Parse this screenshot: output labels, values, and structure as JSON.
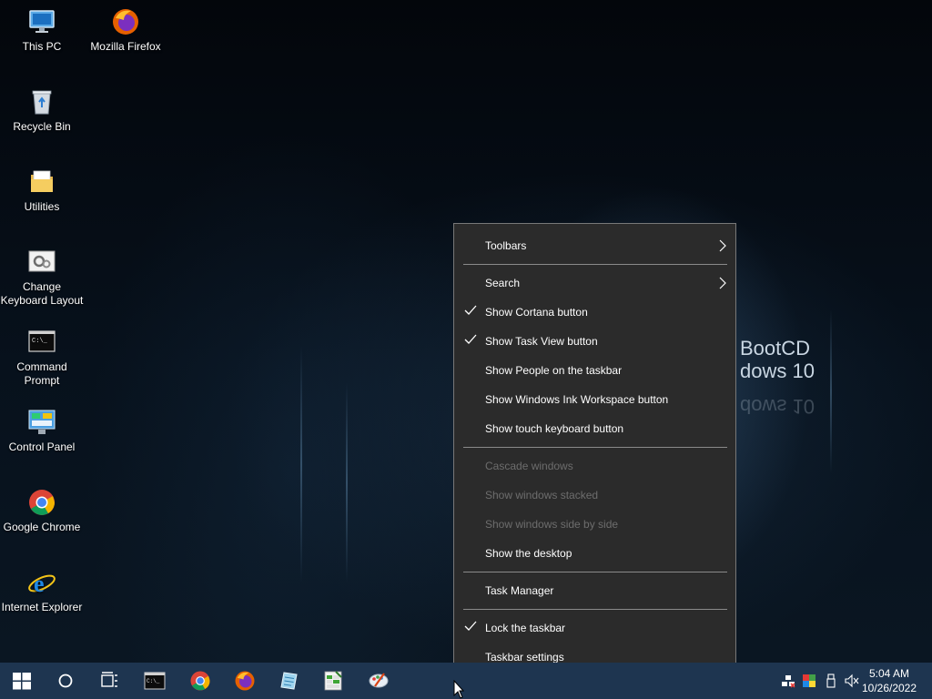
{
  "wallpaper": {
    "line1": "BootCD",
    "line2": "dows 10"
  },
  "desktop_icons": [
    {
      "label": "This PC",
      "icon": "computer-icon"
    },
    {
      "label": "Mozilla Firefox",
      "icon": "firefox-icon"
    },
    {
      "label": "Recycle Bin",
      "icon": "recycle-bin-icon"
    },
    {
      "label": "Utilities",
      "icon": "folder-icon"
    },
    {
      "label": "Change Keyboard Layout",
      "icon": "keyboard-settings-icon"
    },
    {
      "label": "Command Prompt",
      "icon": "command-prompt-icon"
    },
    {
      "label": "Control Panel",
      "icon": "control-panel-icon"
    },
    {
      "label": "Google Chrome",
      "icon": "chrome-icon"
    },
    {
      "label": "Internet Explorer",
      "icon": "internet-explorer-icon"
    }
  ],
  "context_menu": {
    "toolbars": "Toolbars",
    "search": "Search",
    "show_cortana": "Show Cortana button",
    "show_task_view": "Show Task View button",
    "show_people": "Show People on the taskbar",
    "show_ink": "Show Windows Ink Workspace button",
    "show_touch_keyboard": "Show touch keyboard button",
    "cascade": "Cascade windows",
    "stacked": "Show windows stacked",
    "side_by_side": "Show windows side by side",
    "show_desktop": "Show the desktop",
    "task_manager": "Task Manager",
    "lock_taskbar": "Lock the taskbar",
    "taskbar_settings": "Taskbar settings"
  },
  "taskbar": {
    "pinned": [
      "start-icon",
      "cortana-search-icon",
      "task-view-icon",
      "command-prompt-icon",
      "chrome-icon",
      "firefox-icon",
      "notepad-icon",
      "spreadsheet-icon",
      "paint-icon"
    ],
    "tray": [
      "network-icon",
      "color-display-icon",
      "usb-icon",
      "volume-muted-icon"
    ]
  },
  "clock": {
    "time": "5:04 AM",
    "date": "10/26/2022"
  },
  "colors": {
    "taskbar": "#1e3550",
    "menu_bg": "#2b2b2b",
    "menu_disabled_text": "#6d6d6d"
  }
}
